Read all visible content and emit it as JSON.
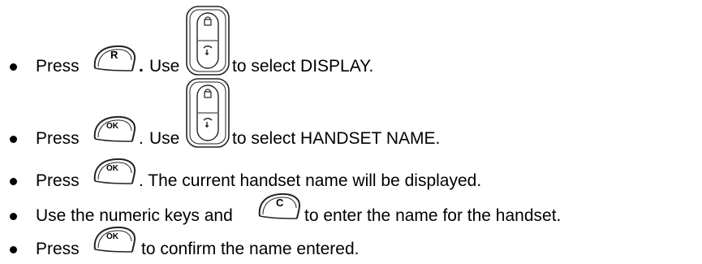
{
  "steps": [
    {
      "press": "Press",
      "key1": "R",
      "dot": ".",
      "use": "Use",
      "action": "to select DISPLAY."
    },
    {
      "press": "Press",
      "key1": "OK",
      "dot": ".",
      "use": "Use",
      "action": "to select HANDSET NAME."
    },
    {
      "press": "Press",
      "key1": "OK",
      "action": ". The current handset name will be displayed."
    },
    {
      "before": "Use the numeric keys and",
      "key1": "C",
      "action": "to enter the name for the handset."
    },
    {
      "press": "Press",
      "key1": "OK",
      "action": "to confirm the name entered."
    }
  ],
  "icons": {
    "soft_key": "soft-key-icon",
    "navigation": "up-down-navigation-icon",
    "up_glyph": "phonebook-icon",
    "down_glyph": "redial-icon"
  },
  "colors": {
    "text": "#000000",
    "icon_stroke": "#222222",
    "background": "#ffffff"
  }
}
